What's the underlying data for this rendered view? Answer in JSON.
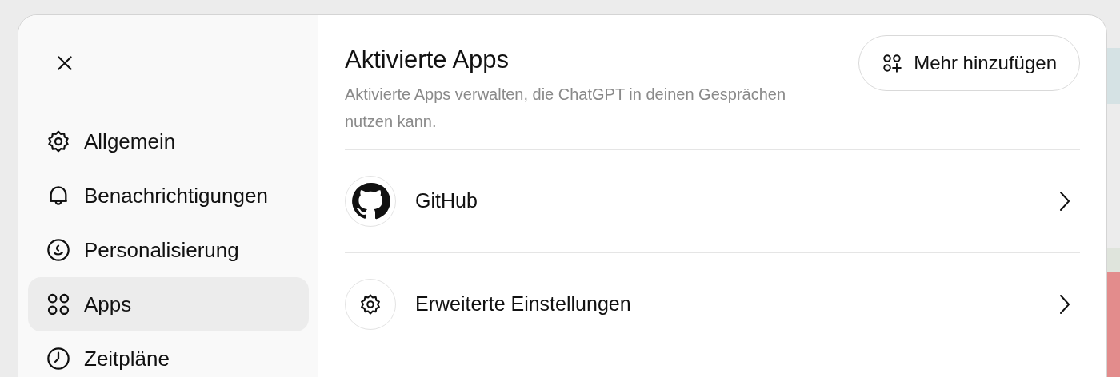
{
  "sidebar": {
    "items": [
      {
        "label": "Allgemein",
        "selected": false
      },
      {
        "label": "Benachrichtigungen",
        "selected": false
      },
      {
        "label": "Personalisierung",
        "selected": false
      },
      {
        "label": "Apps",
        "selected": true
      },
      {
        "label": "Zeitpläne",
        "selected": false
      }
    ]
  },
  "header": {
    "title": "Aktivierte Apps",
    "description": "Aktivierte Apps verwalten, die ChatGPT in deinen Gesprächen nutzen kann.",
    "button": "Mehr hinzufügen"
  },
  "apps": [
    {
      "name": "GitHub"
    },
    {
      "name": "Erweiterte Einstellungen"
    }
  ]
}
